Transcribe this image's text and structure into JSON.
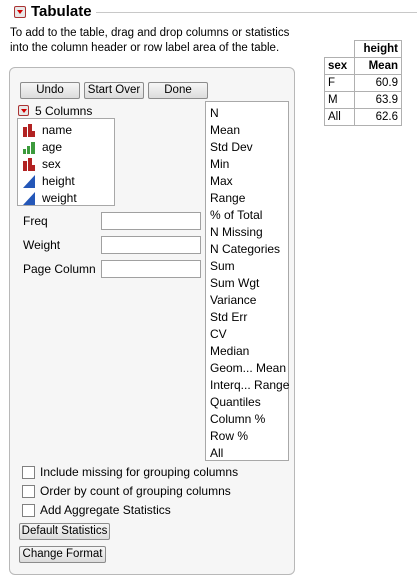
{
  "header": {
    "title": "Tabulate",
    "instructions_line1": "To add to the table, drag and drop columns or statistics",
    "instructions_line2": "into the column header or row label area of the table."
  },
  "toolbar": {
    "undo_label": "Undo",
    "start_over_label": "Start Over",
    "done_label": "Done"
  },
  "columns_panel": {
    "header_label": "5 Columns",
    "items": [
      {
        "label": "name",
        "icon": "nominal-icon",
        "color": "#b22222"
      },
      {
        "label": "age",
        "icon": "ordinal-icon",
        "color": "#3c9a3c"
      },
      {
        "label": "sex",
        "icon": "nominal-icon",
        "color": "#b22222"
      },
      {
        "label": "height",
        "icon": "continuous-icon",
        "color": "#2457b8"
      },
      {
        "label": "weight",
        "icon": "continuous-icon",
        "color": "#2457b8"
      }
    ]
  },
  "fields": {
    "freq_label": "Freq",
    "freq_value": "",
    "weight_label": "Weight",
    "weight_value": "",
    "page_column_label": "Page Column",
    "page_column_value": ""
  },
  "statistics": [
    "N",
    "Mean",
    "Std Dev",
    "Min",
    "Max",
    "Range",
    "% of Total",
    "N Missing",
    "N Categories",
    "Sum",
    "Sum Wgt",
    "Variance",
    "Std Err",
    "CV",
    "Median",
    "Geom... Mean",
    "Interq... Range",
    "Quantiles",
    "Column %",
    "Row %",
    "All"
  ],
  "options": {
    "include_missing_label": "Include missing for grouping columns",
    "order_by_count_label": "Order by count of grouping columns",
    "add_aggregate_label": "Add Aggregate Statistics",
    "include_missing_checked": false,
    "order_by_count_checked": false,
    "add_aggregate_checked": false
  },
  "bottom_buttons": {
    "default_statistics_label": "Default Statistics",
    "change_format_label": "Change Format"
  },
  "result_table": {
    "column_header": "height",
    "row_header": "sex",
    "stat_header": "Mean",
    "rows": [
      {
        "label": "F",
        "value": "60.9"
      },
      {
        "label": "M",
        "value": "63.9"
      },
      {
        "label": "All",
        "value": "62.6"
      }
    ]
  }
}
